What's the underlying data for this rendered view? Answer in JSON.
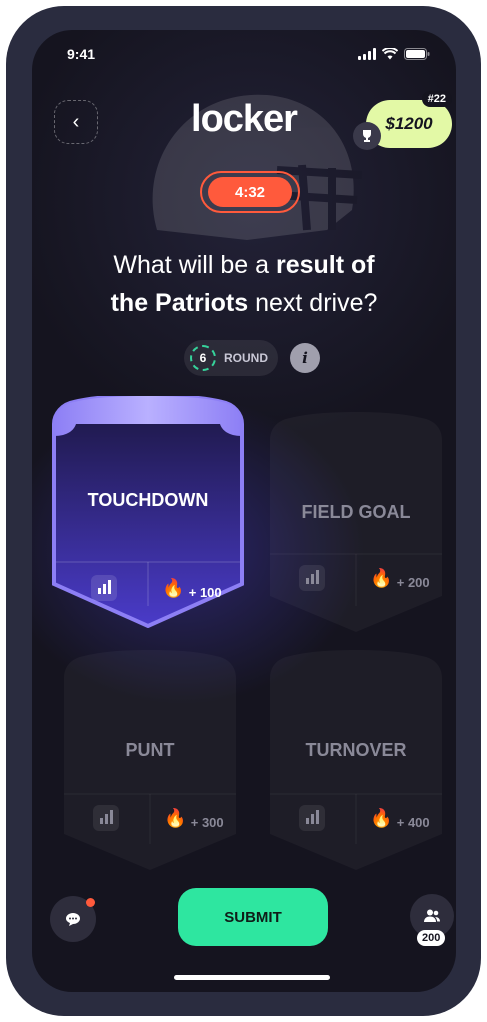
{
  "status": {
    "time": "9:41"
  },
  "header": {
    "logo": "locker",
    "prize": "$1200",
    "rank": "#22"
  },
  "timer": "4:32",
  "question": {
    "part1": "What will be a ",
    "bold1": "result of",
    "bold2": "the Patriots",
    "part2": " next drive?"
  },
  "round": {
    "number": "6",
    "label": "ROUND",
    "info_glyph": "i"
  },
  "options": [
    {
      "label": "TOUCHDOWN",
      "points": "+ 100",
      "selected": true
    },
    {
      "label": "FIELD GOAL",
      "points": "+ 200",
      "selected": false
    },
    {
      "label": "PUNT",
      "points": "+ 300",
      "selected": false
    },
    {
      "label": "TURNOVER",
      "points": "+ 400",
      "selected": false
    }
  ],
  "footer": {
    "submit_label": "SUBMIT",
    "players_count": "200"
  },
  "colors": {
    "accent": "#2ee6a0",
    "timer": "#ff5a3c",
    "prize_bg": "#e3f9a6",
    "selected_card": "#6c5cf0"
  }
}
